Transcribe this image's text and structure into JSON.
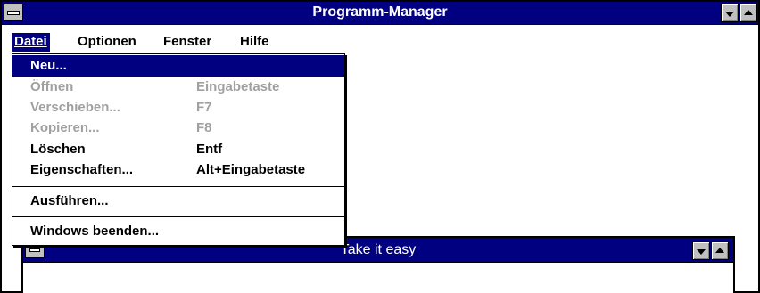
{
  "window": {
    "title": "Programm-Manager",
    "menu": [
      {
        "label": "Datei",
        "accelerator": "D"
      },
      {
        "label": "Optionen",
        "accelerator": "O"
      },
      {
        "label": "Fenster",
        "accelerator": "F"
      },
      {
        "label": "Hilfe",
        "accelerator": "H"
      }
    ]
  },
  "dropdown": {
    "items": [
      {
        "label": "Neu...",
        "shortcut": "",
        "enabled": true,
        "highlighted": true
      },
      {
        "label": "Öffnen",
        "shortcut": "Eingabetaste",
        "enabled": false,
        "highlighted": false
      },
      {
        "label": "Verschieben...",
        "shortcut": "F7",
        "enabled": false,
        "highlighted": false
      },
      {
        "label": "Kopieren...",
        "shortcut": "F8",
        "enabled": false,
        "highlighted": false
      },
      {
        "label": "Löschen",
        "shortcut": "Entf",
        "enabled": true,
        "highlighted": false
      },
      {
        "label": "Eigenschaften...",
        "shortcut": "Alt+Eingabetaste",
        "enabled": true,
        "highlighted": false
      },
      {
        "label": "Ausführen...",
        "shortcut": "",
        "enabled": true,
        "highlighted": false
      },
      {
        "label": "Windows beenden...",
        "shortcut": "",
        "enabled": true,
        "highlighted": false
      }
    ]
  },
  "child_window": {
    "title": "Take it easy"
  },
  "colors": {
    "title_bar": "#000080",
    "highlight": "#000080",
    "disabled_text": "#a0a0a0",
    "button_face": "#c0c0c0"
  }
}
